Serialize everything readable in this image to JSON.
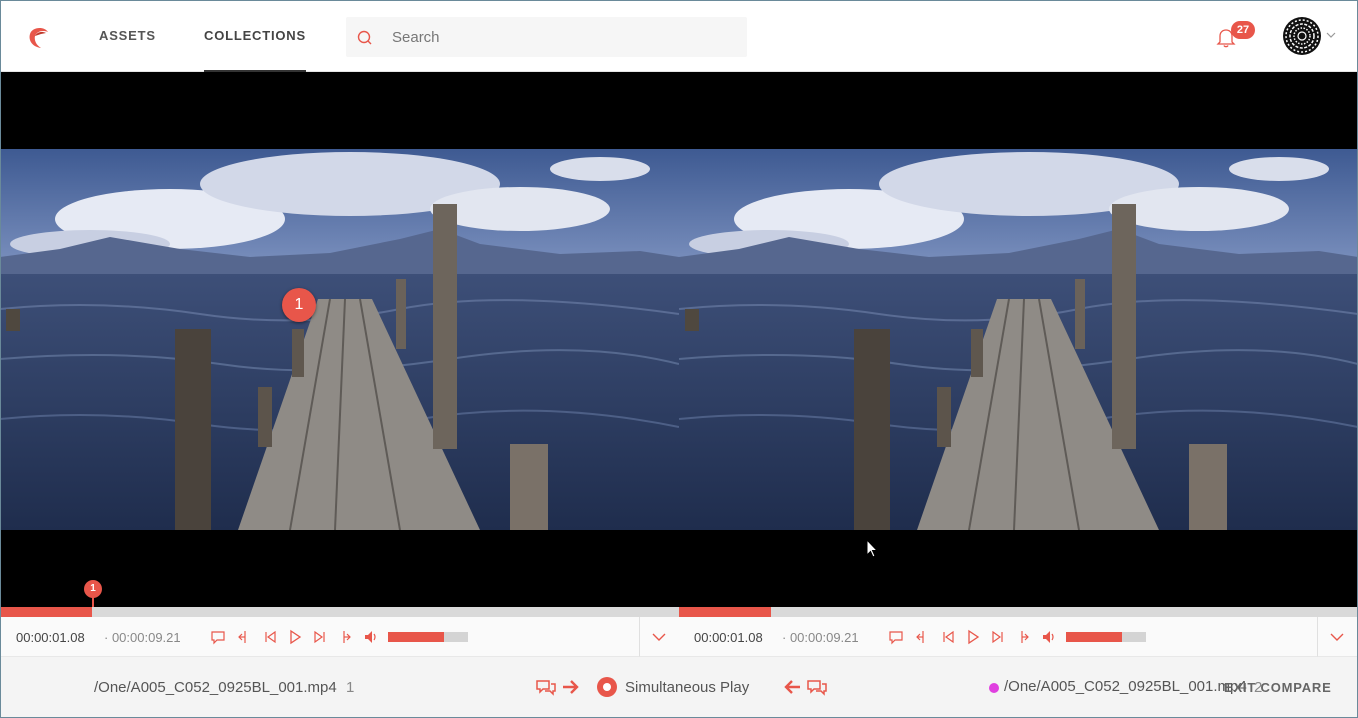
{
  "header": {
    "logo": "bird-logo",
    "nav": [
      {
        "label": "ASSETS",
        "active": false
      },
      {
        "label": "COLLECTIONS",
        "active": true
      }
    ],
    "search": {
      "placeholder": "Search",
      "value": ""
    },
    "notifications": {
      "count": "27"
    },
    "avatar": "user-avatar"
  },
  "player_left": {
    "comment_pin_number": "1",
    "timeline_marker_number": "1",
    "progress": 0.136,
    "timecode": "00:00:01.08",
    "duration": "· 00:00:09.21",
    "volume": 0.7
  },
  "player_right": {
    "progress": 0.136,
    "timecode": "00:00:01.08",
    "duration": "· 00:00:09.21",
    "volume": 0.7
  },
  "footer": {
    "left_file": "/One/A005_C052_0925BL_001.mp4",
    "left_count": "1",
    "simultaneous_play_label": "Simultaneous Play",
    "simultaneous_play_on": true,
    "right_file": "/One/A005_C052_0925BL_001.mp4",
    "right_count": "2",
    "exit_label": "EXIT COMPARE"
  },
  "colors": {
    "accent": "#e8564a",
    "marker_pink": "#e040e0",
    "stage_bg": "#000000"
  }
}
